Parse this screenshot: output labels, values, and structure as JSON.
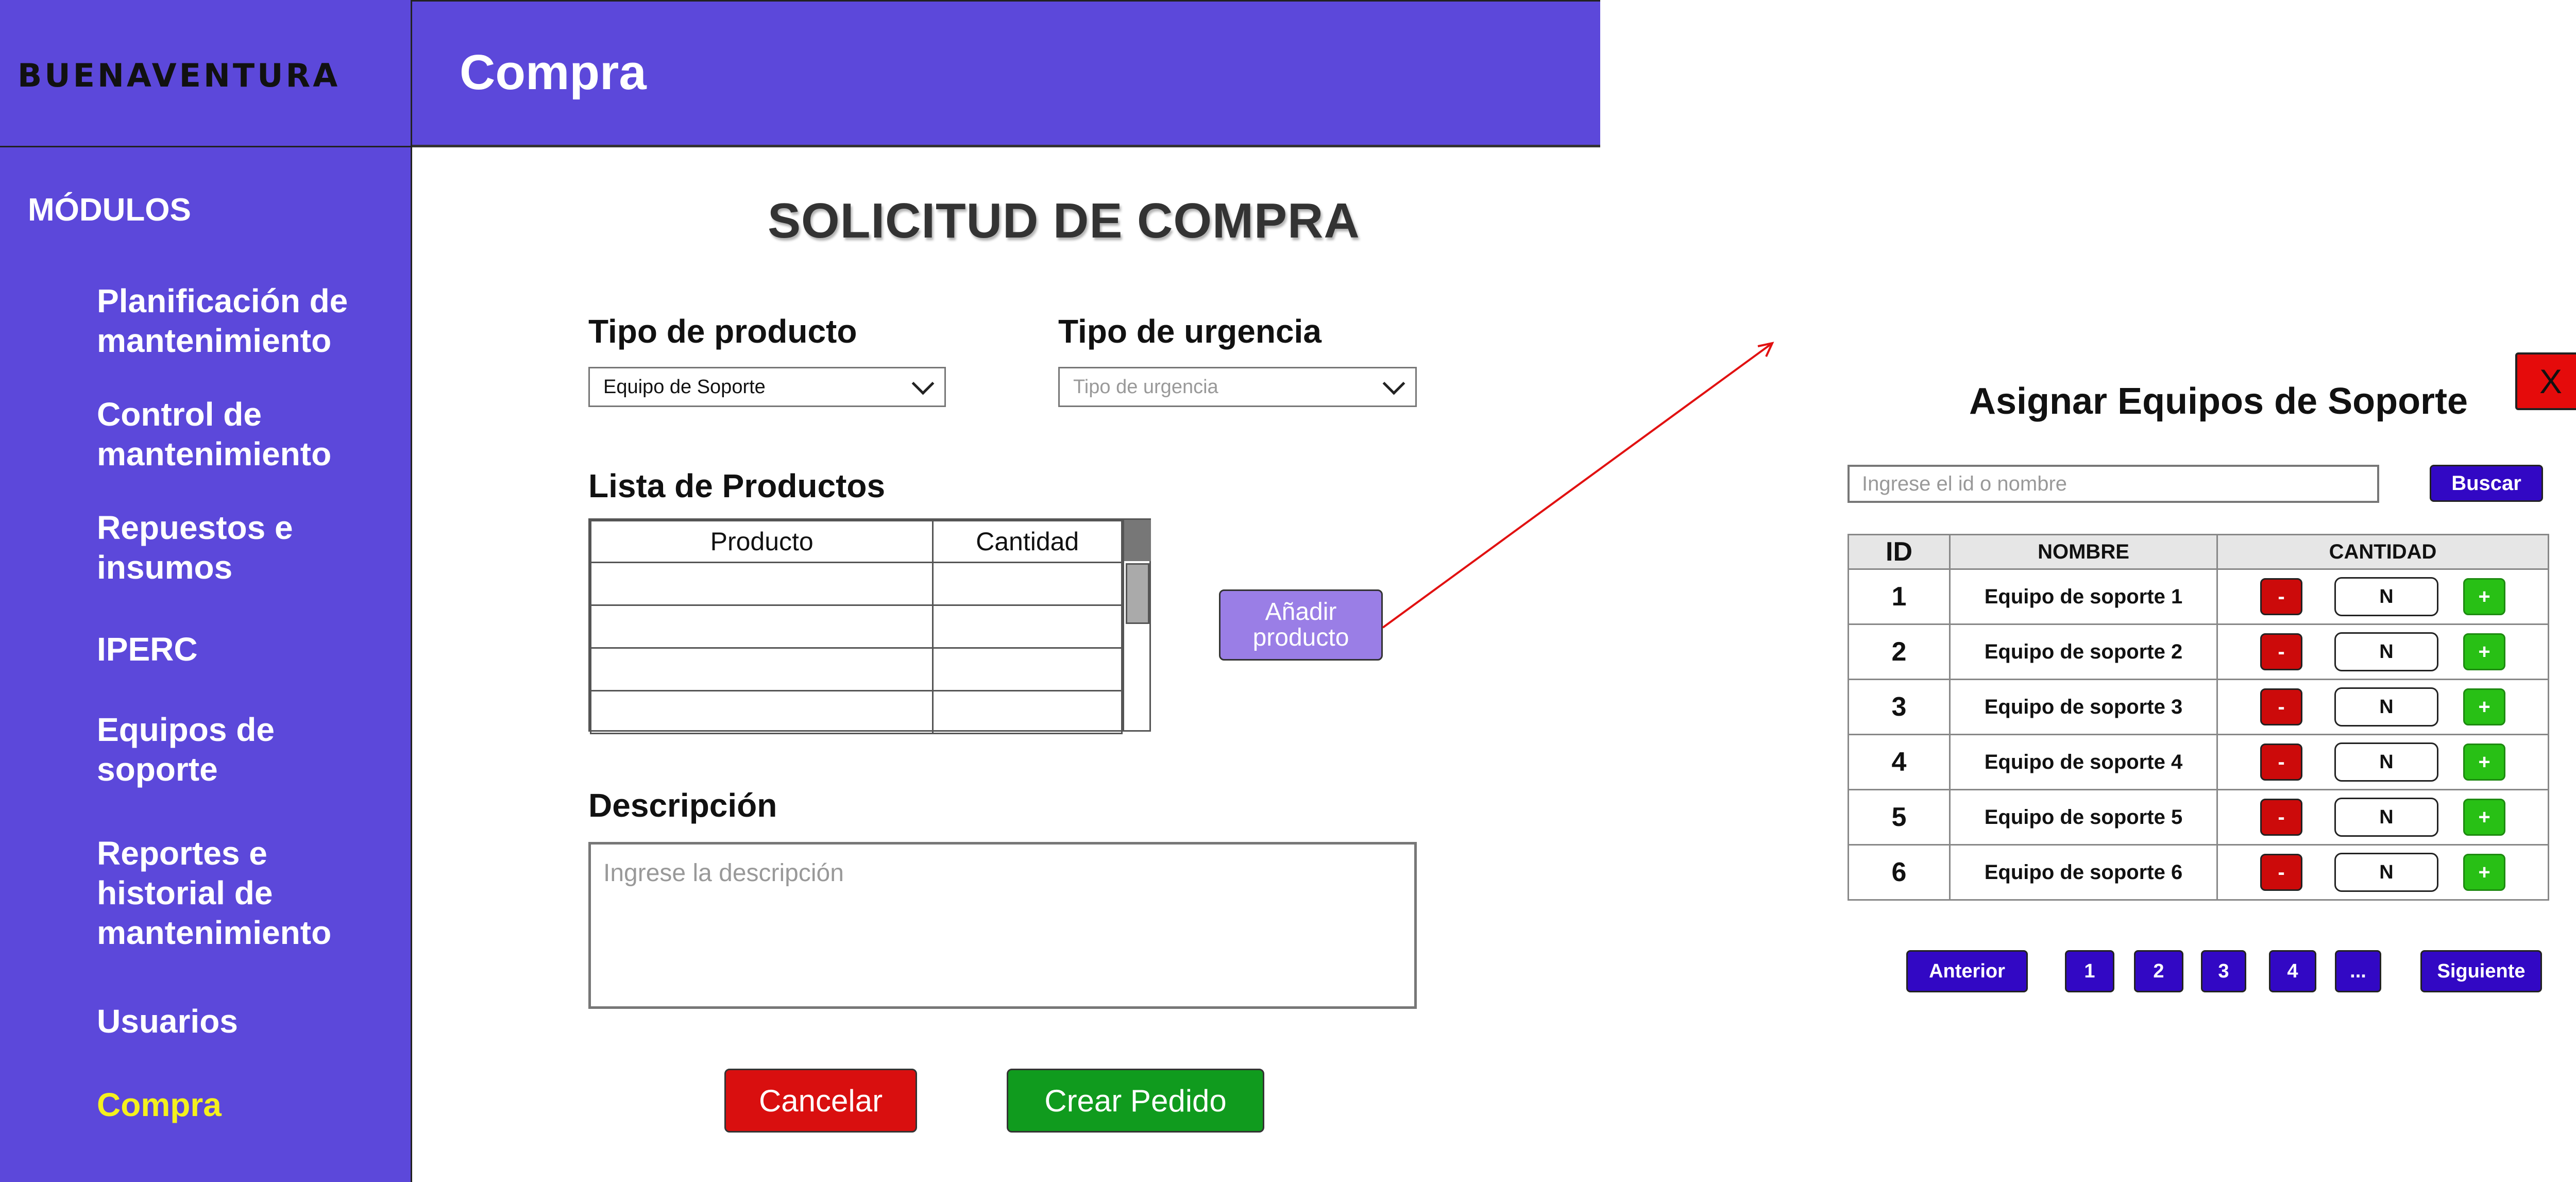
{
  "app": {
    "logo_text": "BUENAVENTURA"
  },
  "header": {
    "title": "Compra"
  },
  "sidebar": {
    "title": "MÓDULOS",
    "items": [
      {
        "label": "Planificación de mantenimiento"
      },
      {
        "label": "Control de mantenimiento"
      },
      {
        "label": "Repuestos e insumos"
      },
      {
        "label": "IPERC"
      },
      {
        "label": "Equipos de soporte"
      },
      {
        "label": "Reportes e historial de mantenimiento"
      },
      {
        "label": "Usuarios"
      },
      {
        "label": "Compra",
        "active": true
      }
    ]
  },
  "form": {
    "title": "SOLICITUD DE COMPRA",
    "product_type": {
      "label": "Tipo de producto",
      "value": "Equipo de Soporte"
    },
    "urgency_type": {
      "label": "Tipo de urgencia",
      "placeholder": "Tipo de urgencia"
    },
    "product_list": {
      "label": "Lista de Productos",
      "columns": [
        "Producto",
        "Cantidad"
      ],
      "rows": 4
    },
    "add_product_label": "Añadir producto",
    "description": {
      "label": "Descripción",
      "placeholder": "Ingrese la descripción"
    },
    "cancel_label": "Cancelar",
    "create_label": "Crear Pedido"
  },
  "modal": {
    "title": "Asignar Equipos de Soporte",
    "close_label": "X",
    "search_placeholder": "Ingrese el id o nombre",
    "search_button": "Buscar",
    "columns": [
      "ID",
      "NOMBRE",
      "CANTIDAD"
    ],
    "rows": [
      {
        "id": "1",
        "name": "Equipo de soporte 1",
        "qty": "N"
      },
      {
        "id": "2",
        "name": "Equipo de soporte 2",
        "qty": "N"
      },
      {
        "id": "3",
        "name": "Equipo de soporte 3",
        "qty": "N"
      },
      {
        "id": "4",
        "name": "Equipo de soporte 4",
        "qty": "N"
      },
      {
        "id": "5",
        "name": "Equipo de soporte 5",
        "qty": "N"
      },
      {
        "id": "6",
        "name": "Equipo de soporte 6",
        "qty": "N"
      }
    ],
    "minus_label": "-",
    "plus_label": "+",
    "pagination": {
      "prev": "Anterior",
      "pages": [
        "1",
        "2",
        "3",
        "4",
        "..."
      ],
      "next": "Siguiente"
    }
  },
  "colors": {
    "sidebar_bg": "#5c48da",
    "active_nav": "#f4f01e",
    "primary_button": "#3208c4",
    "cancel_red": "#d90f0f",
    "create_green": "#109b1e",
    "connector_line": "#e11111"
  }
}
